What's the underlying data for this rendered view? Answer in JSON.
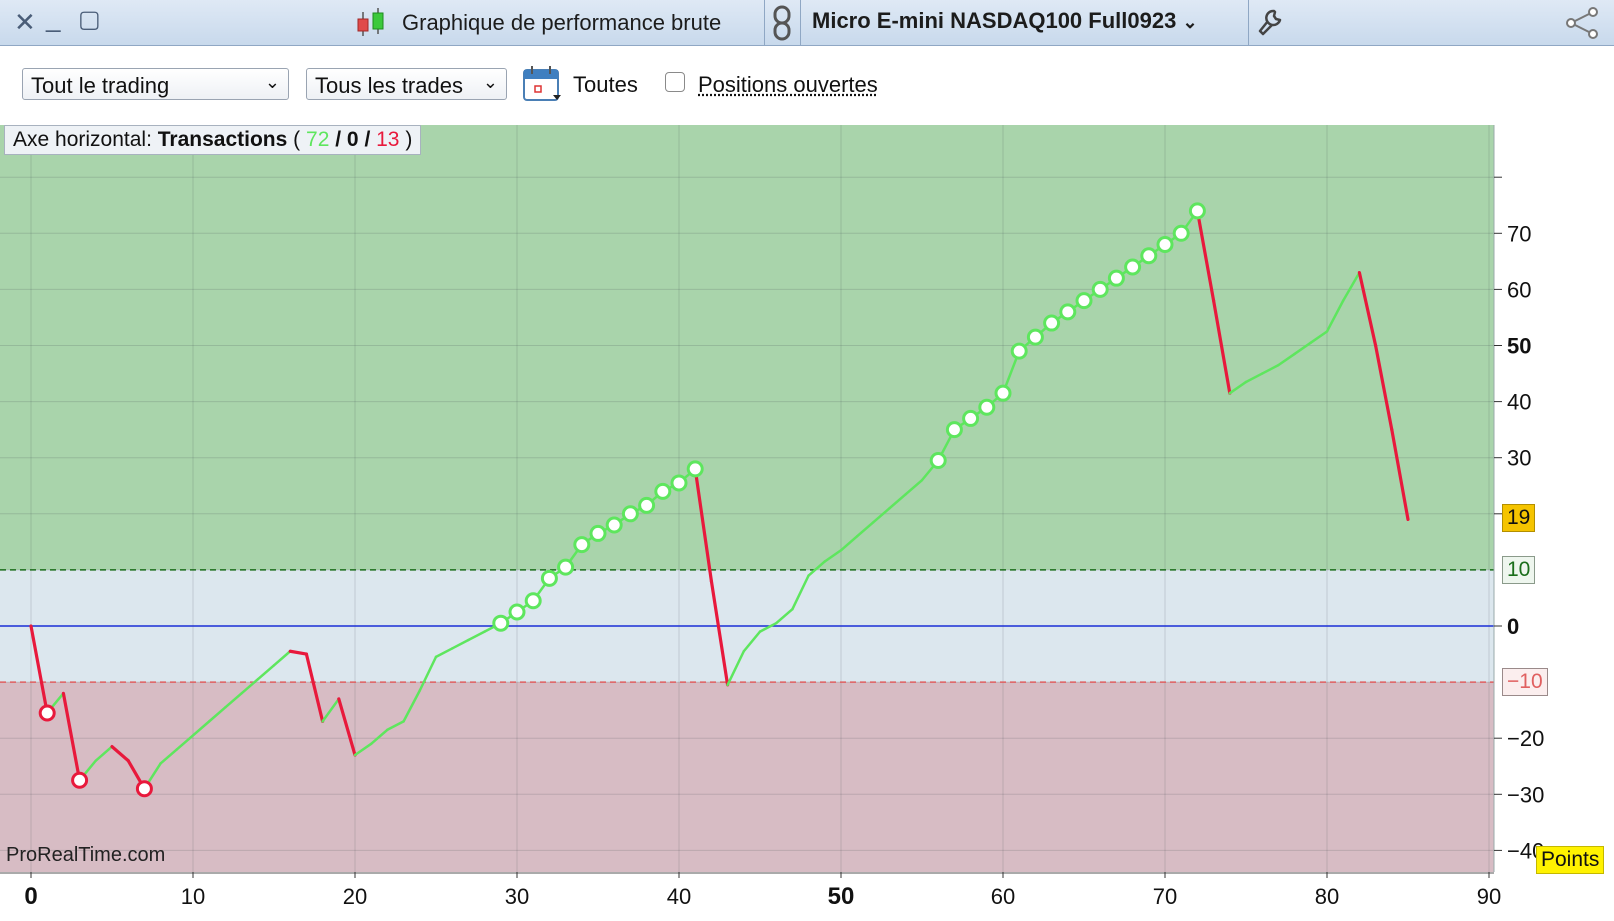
{
  "window": {
    "title": "Graphique de performance brute",
    "instrument": "Micro E-mini NASDAQ100 Full0923"
  },
  "toolbar": {
    "scope_select": "Tout le trading",
    "trades_select": "Tous les trades",
    "period_label": "Toutes",
    "open_positions_label": "Positions ouvertes",
    "open_positions_checked": false
  },
  "axis_info": {
    "prefix": "Axe horizontal:",
    "mode": "Transactions",
    "open": "(",
    "wins": "72",
    "sep1": "/",
    "neutral": "0",
    "sep2": "/",
    "losses": "13",
    "close": ")"
  },
  "watermark": "ProRealTime.com",
  "units_label": "Points",
  "colors": {
    "win": "#5ee65e",
    "loss": "#e8193c",
    "zero_line": "#1a2fd6",
    "upper_threshold": "#1b6e1b",
    "lower_threshold": "#e06060",
    "current_badge": "#f5c400"
  },
  "chart_data": {
    "type": "line",
    "xlabel": "",
    "ylabel": "",
    "xlim": [
      0,
      90
    ],
    "ylim": [
      -40,
      80
    ],
    "x_ticks": [
      "0",
      "10",
      "20",
      "30",
      "40",
      "50",
      "60",
      "70",
      "80",
      "90"
    ],
    "y_ticks": [
      "70",
      "60",
      "50",
      "40",
      "30",
      "20",
      "0",
      "−20",
      "−30",
      "−40"
    ],
    "thresholds": {
      "upper": "10",
      "lower": "−10"
    },
    "current_value": "19",
    "series": [
      {
        "x": [
          0,
          1,
          2,
          3,
          4,
          5,
          6,
          7,
          8,
          9,
          10,
          11,
          12,
          13,
          14,
          15,
          16,
          17,
          18,
          19,
          20,
          21,
          22,
          23,
          24,
          25,
          26,
          27,
          28,
          29,
          30,
          31,
          32,
          33,
          34,
          35,
          36,
          37,
          38,
          39,
          40,
          41,
          42,
          43,
          44,
          45,
          46,
          47,
          48,
          49,
          50,
          51,
          52,
          53,
          54,
          55,
          56,
          57,
          58,
          59,
          60,
          61,
          62,
          63,
          64,
          65,
          66,
          67,
          68,
          69,
          70,
          71,
          72,
          73,
          74,
          75,
          76,
          77,
          78,
          79,
          80,
          81,
          82,
          83,
          84,
          85
        ],
        "y": [
          0,
          -15.5,
          -12,
          -27.5,
          -24,
          -21.5,
          -24,
          -29,
          -24.5,
          -22,
          -19.5,
          -17,
          -14.5,
          -12,
          -9.5,
          -7,
          -4.5,
          -5,
          -17,
          -13,
          -23,
          -21,
          -18.5,
          -17,
          -11.5,
          -5.5,
          -4,
          -2.5,
          -1,
          0.5,
          2.5,
          4.5,
          8.5,
          10.5,
          14.5,
          16.5,
          18,
          20,
          21.5,
          24,
          25.5,
          28,
          8,
          -10.5,
          -4.5,
          -1,
          0.5,
          3,
          9,
          11.5,
          13.5,
          16,
          18.5,
          21,
          23.5,
          26,
          29.5,
          35,
          37,
          39,
          41.5,
          49,
          51.5,
          54,
          56,
          58,
          60,
          62,
          64,
          66,
          68,
          70,
          74,
          58,
          41.5,
          43.5,
          45,
          46.5,
          48.5,
          50.5,
          52.5,
          58,
          63,
          50,
          35,
          19
        ]
      }
    ],
    "marked_points_x": [
      1,
      3,
      7,
      29,
      30,
      31,
      32,
      33,
      34,
      35,
      36,
      37,
      38,
      39,
      40,
      41,
      56,
      57,
      58,
      59,
      60,
      61,
      62,
      63,
      64,
      65,
      66,
      67,
      68,
      69,
      70,
      71,
      72
    ]
  }
}
